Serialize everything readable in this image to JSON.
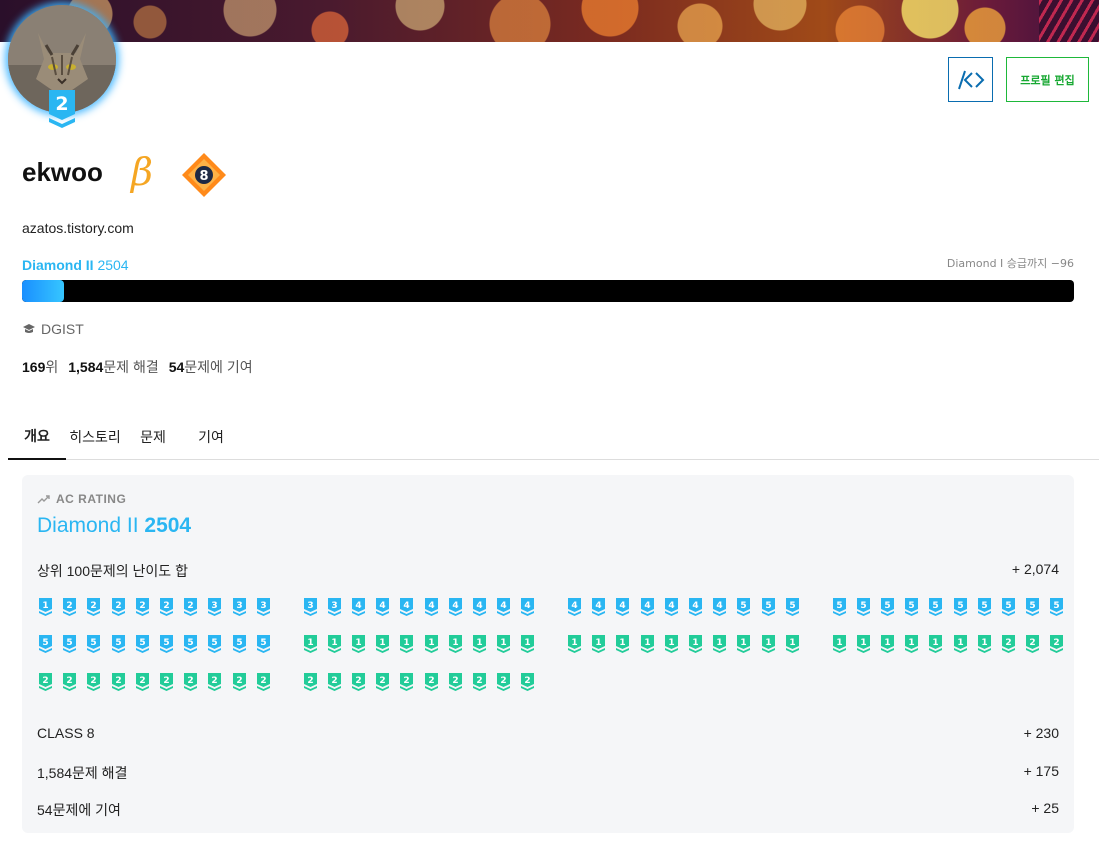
{
  "profile": {
    "username": "ekwoo",
    "beta_mark": "β",
    "homepage": "azatos.tistory.com",
    "avatar_tier_level": "2",
    "class_level": "8",
    "tier_name": "Diamond II",
    "rating": "2504",
    "promotion_text": "Diamond I 승급까지 −96",
    "rating_progress_fraction": 0.04,
    "organization": "DGIST",
    "rank_value": "169",
    "rank_suffix": "위",
    "solved_value": "1,584",
    "solved_suffix": "문제 해결",
    "contrib_value": "54",
    "contrib_suffix": "문제에 기여"
  },
  "buttons": {
    "edit_profile": "프로필 편집"
  },
  "tabs": [
    "개요",
    "히스토리",
    "문제",
    "기여"
  ],
  "rating_card": {
    "header": "AC RATING",
    "tier_name": "Diamond II",
    "rating": "2504",
    "rows": {
      "top100_label": "상위 100문제의 난이도 합",
      "top100_value": "+ 2,074",
      "class_label": "CLASS 8",
      "class_value": "+ 230",
      "solved_label": "1,584문제 해결",
      "solved_value": "+ 175",
      "contrib_label": "54문제에 기여",
      "contrib_value": "+ 25"
    },
    "top100_badges": [
      [
        "p1",
        "p2",
        "p2",
        "p2",
        "p2",
        "p2",
        "p2",
        "p3",
        "p3",
        "p3",
        "p3",
        "p3",
        "p4",
        "p4",
        "p4",
        "p4",
        "p4",
        "p4",
        "p4",
        "p4",
        "p4",
        "p4",
        "p4",
        "p4",
        "p4",
        "p4",
        "p4",
        "p5",
        "p5",
        "p5",
        "p5",
        "p5",
        "p5",
        "p5",
        "p5",
        "p5",
        "p5",
        "p5",
        "p5",
        "p5"
      ],
      [
        "p5",
        "p5",
        "p5",
        "p5",
        "p5",
        "p5",
        "p5",
        "p5",
        "p5",
        "p5",
        "r1",
        "r1",
        "r1",
        "r1",
        "r1",
        "r1",
        "r1",
        "r1",
        "r1",
        "r1",
        "r1",
        "r1",
        "r1",
        "r1",
        "r1",
        "r1",
        "r1",
        "r1",
        "r1",
        "r1",
        "r1",
        "r1",
        "r1",
        "r1",
        "r1",
        "r1",
        "r1",
        "r2",
        "r2",
        "r2"
      ],
      [
        "r2",
        "r2",
        "r2",
        "r2",
        "r2",
        "r2",
        "r2",
        "r2",
        "r2",
        "r2",
        "r2",
        "r2",
        "r2",
        "r2",
        "r2",
        "r2",
        "r2",
        "r2",
        "r2",
        "r2"
      ]
    ]
  },
  "colors": {
    "diamond": "#2ab6f2",
    "ruby": "#22cc99",
    "edit_button": "#17a832",
    "code_button": "#0a6db0",
    "class_badge": "#ff7a00"
  },
  "icons": {
    "code": "code-icon",
    "organization": "graduation-cap-icon",
    "rating_trend": "trend-up-icon"
  }
}
